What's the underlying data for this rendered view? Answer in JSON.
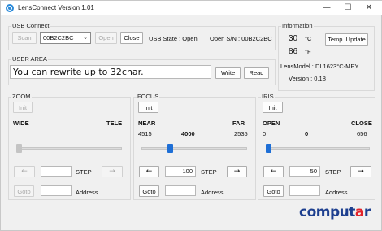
{
  "window": {
    "title": "LensConnect  Version 1.01",
    "minimize": "—",
    "maximize": "☐",
    "close": "✕"
  },
  "usb": {
    "group_label": "USB Connect",
    "scan_label": "Scan",
    "device_value": "00B2C2BC",
    "open_label": "Open",
    "close_label": "Close",
    "state_text": "USB State : Open",
    "serial_text": "Open S/N :  00B2C2BC"
  },
  "info": {
    "group_label": "Information",
    "temp_c": "30",
    "unit_c": "°C",
    "temp_f": "86",
    "unit_f": "°F",
    "temp_update_label": "Temp. Update",
    "lens_model": "LensModel : DL1623°C-MPY",
    "version": "Version :  0.18"
  },
  "user_area": {
    "group_label": "USER AREA",
    "text_value": "You can rewrite up to 32char.",
    "write_label": "Write",
    "read_label": "Read"
  },
  "zoom": {
    "group_label": "ZOOM",
    "init_label": "Init",
    "min_label": "WIDE",
    "max_label": "TELE",
    "left_label": "←",
    "right_label": "→",
    "step_label": "STEP",
    "step_value": "",
    "goto_label": "Goto",
    "address_label": "Address",
    "address_value": "",
    "position_fraction": 0.0,
    "enabled": false
  },
  "focus": {
    "group_label": "FOCUS",
    "init_label": "Init",
    "min_label": "NEAR",
    "max_label": "FAR",
    "current": "4000",
    "min_value": "4515",
    "max_value": "2535",
    "left_label": "←",
    "right_label": "→",
    "step_label": "STEP",
    "step_value": "100",
    "goto_label": "Goto",
    "address_label": "Address",
    "address_value": "",
    "position_fraction": 0.26,
    "enabled": true
  },
  "iris": {
    "group_label": "IRIS",
    "init_label": "Init",
    "min_label": "OPEN",
    "max_label": "CLOSE",
    "current": "0",
    "min_value": "0",
    "max_value": "656",
    "left_label": "←",
    "right_label": "→",
    "step_label": "STEP",
    "step_value": "50",
    "goto_label": "Goto",
    "address_label": "Address",
    "address_value": "",
    "position_fraction": 0.0,
    "enabled": true
  },
  "logo": {
    "main": "comput",
    "accent": "a",
    "tail": "r"
  },
  "colors": {
    "accent": "#1e6fd6",
    "logo_blue": "#1d3f8f",
    "logo_red": "#e2232a"
  }
}
